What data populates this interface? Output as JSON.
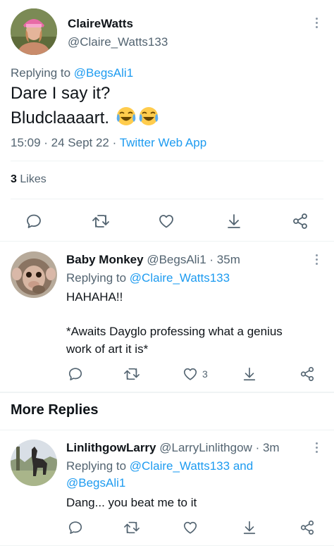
{
  "main_tweet": {
    "author_name": "ClaireWatts",
    "author_handle": "@Claire_Watts133",
    "replying_label": "Replying to",
    "replying_handle": "@BegsAli1",
    "text_line1": "Dare I say it?",
    "text_line2": "Bludclaaaart.",
    "timestamp": "15:09 · 24 Sept 22 ·",
    "source": "Twitter Web App",
    "likes_count": "3",
    "likes_label": "Likes"
  },
  "reply1": {
    "author_name": "Baby Monkey",
    "author_handle": "@BegsAli1",
    "time": "· 35m",
    "replying_label": "Replying to",
    "replying_handle": "@Claire_Watts133",
    "text_line1": "HAHAHA!!",
    "text_line2": "*Awaits Dayglo professing what a genius",
    "text_line3": "work of art it is*",
    "like_count": "3"
  },
  "section": {
    "more_replies": "More Replies"
  },
  "reply2": {
    "author_name": "LinlithgowLarry",
    "author_handle": "@LarryLinlithgow",
    "time": "· 3m",
    "replying_label": "Replying to",
    "replying_handle1": "@Claire_Watts133",
    "and_label": "and",
    "replying_handle2": "@BegsAli1",
    "text": "Dang... you beat me to it"
  },
  "colors": {
    "accent": "#1d9bf0",
    "muted": "#536471",
    "divider": "#eff3f4"
  },
  "icons": [
    "reply-icon",
    "retweet-icon",
    "like-icon",
    "bookmark-icon",
    "share-icon",
    "more-icon",
    "laughing-emoji"
  ]
}
